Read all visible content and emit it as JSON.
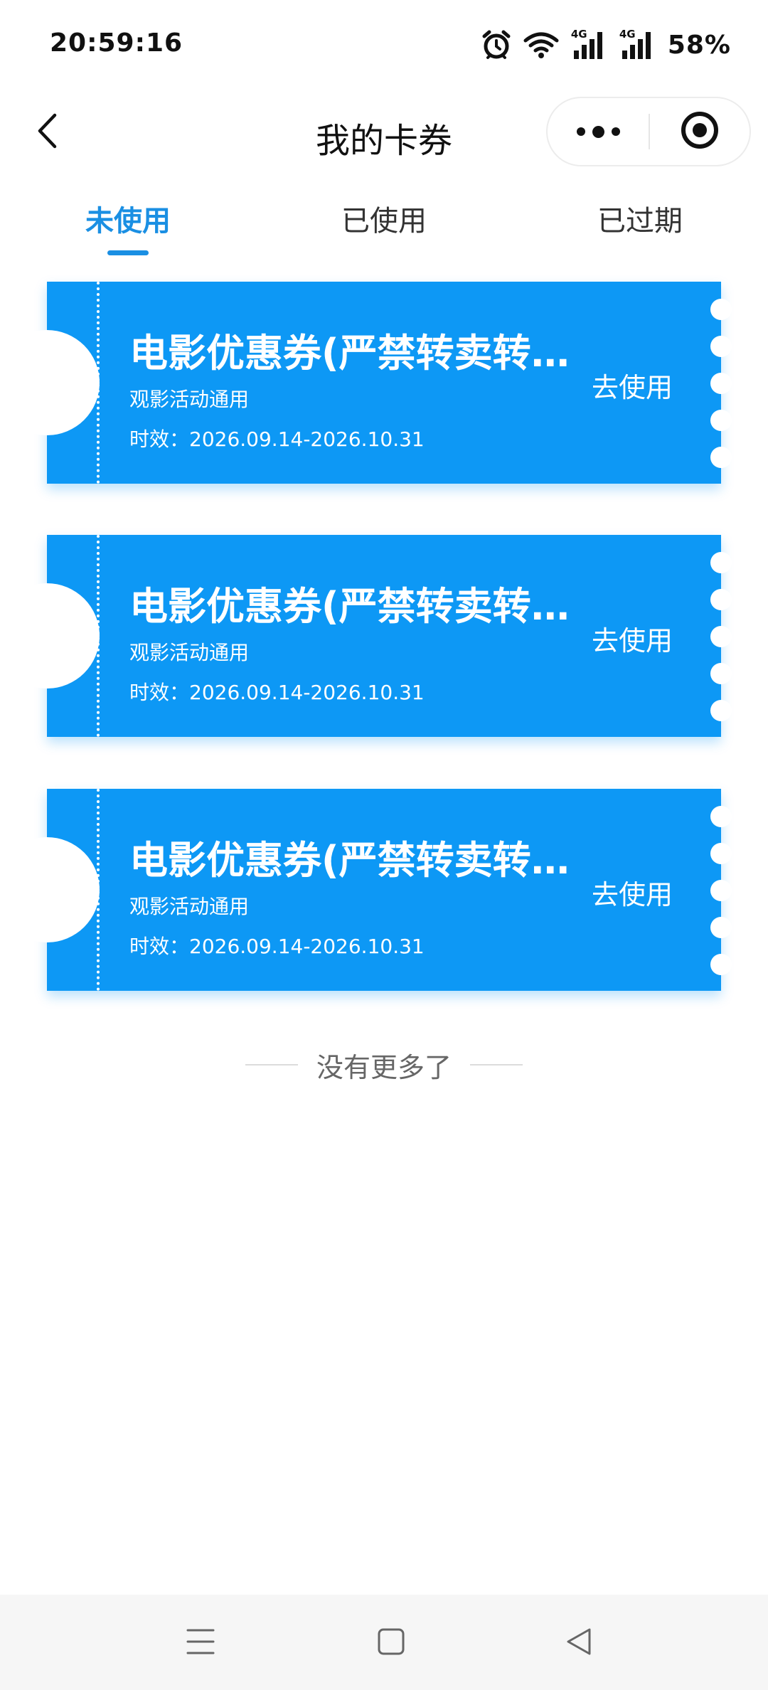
{
  "status_bar": {
    "time": "20:59:16",
    "battery": "58%",
    "network_label_1": "4G",
    "network_label_2": "4G",
    "icons": [
      "alarm-icon",
      "wifi-icon",
      "signal-icon",
      "signal-icon",
      "battery-percent"
    ]
  },
  "nav": {
    "title": "我的卡券",
    "back_icon": "chevron-left-icon",
    "more_icon": "more-dots-icon",
    "close_icon": "target-close-icon"
  },
  "tabs": [
    {
      "label": "未使用",
      "active": true
    },
    {
      "label": "已使用",
      "active": false
    },
    {
      "label": "已过期",
      "active": false
    }
  ],
  "coupons": [
    {
      "title": "电影优惠券(严禁转卖转...",
      "subtitle": "观影活动通用",
      "validity": "时效：2026.09.14-2026.10.31",
      "action": "去使用"
    },
    {
      "title": "电影优惠券(严禁转卖转...",
      "subtitle": "观影活动通用",
      "validity": "时效：2026.09.14-2026.10.31",
      "action": "去使用"
    },
    {
      "title": "电影优惠券(严禁转卖转...",
      "subtitle": "观影活动通用",
      "validity": "时效：2026.09.14-2026.10.31",
      "action": "去使用"
    }
  ],
  "footer": {
    "no_more": "没有更多了"
  },
  "colors": {
    "accent": "#1a8fe3",
    "coupon_bg": "#0d98f5",
    "text_dark": "#111111",
    "background": "#ffffff"
  },
  "system_nav": {
    "icons": [
      "menu-icon",
      "home-square-icon",
      "back-triangle-icon"
    ]
  }
}
